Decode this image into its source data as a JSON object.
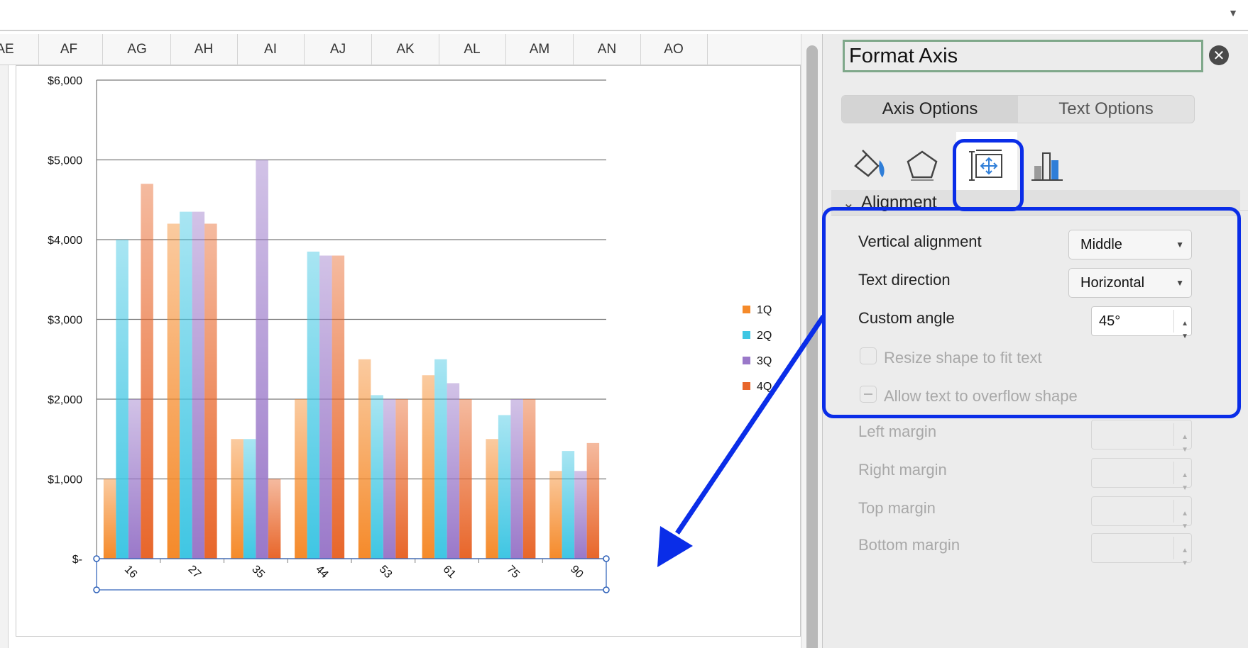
{
  "columns": [
    "AE",
    "AF",
    "AG",
    "AH",
    "AI",
    "AJ",
    "AK",
    "AL",
    "AM",
    "AN",
    "AO"
  ],
  "chart_data": {
    "type": "bar",
    "categories": [
      "16",
      "27",
      "35",
      "44",
      "53",
      "61",
      "75",
      "90"
    ],
    "series": [
      {
        "name": "1Q",
        "values": [
          1000,
          4200,
          1500,
          2000,
          2500,
          2300,
          1500,
          1100
        ],
        "color": "#f58a2a"
      },
      {
        "name": "2Q",
        "values": [
          4000,
          4350,
          1500,
          3850,
          2050,
          2500,
          1800,
          1350
        ],
        "color": "#3fc6e3"
      },
      {
        "name": "3Q",
        "values": [
          2000,
          4350,
          5000,
          3800,
          2000,
          2200,
          2000,
          1100
        ],
        "color": "#9a78c9"
      },
      {
        "name": "4Q",
        "values": [
          4700,
          4200,
          1000,
          3800,
          2000,
          2000,
          2000,
          1450
        ],
        "color": "#e8662a"
      }
    ],
    "y_ticks": [
      "$-",
      "$1,000",
      "$2,000",
      "$3,000",
      "$4,000",
      "$5,000",
      "$6,000"
    ],
    "ylim": [
      0,
      6000
    ],
    "x_label_rotation_deg": 45,
    "grid": true,
    "legend_position": "right"
  },
  "pane": {
    "title": "Format Axis",
    "close_label": "✕",
    "tabs": {
      "axis_options": "Axis Options",
      "text_options": "Text Options"
    },
    "section_title": "Alignment",
    "vertical_alignment_label": "Vertical alignment",
    "vertical_alignment_value": "Middle",
    "text_direction_label": "Text direction",
    "text_direction_value": "Horizontal",
    "custom_angle_label": "Custom angle",
    "custom_angle_value": "45°",
    "resize_label": "Resize shape to fit text",
    "overflow_label": "Allow text to overflow shape",
    "left_margin_label": "Left margin",
    "right_margin_label": "Right margin",
    "top_margin_label": "Top margin",
    "bottom_margin_label": "Bottom margin"
  },
  "icons": {
    "fill_line": "paint-bucket-icon",
    "effects": "pentagon-icon",
    "size_properties": "size-properties-icon",
    "axis_options": "bar-chart-icon"
  },
  "highlight_color": "#0a2de8"
}
